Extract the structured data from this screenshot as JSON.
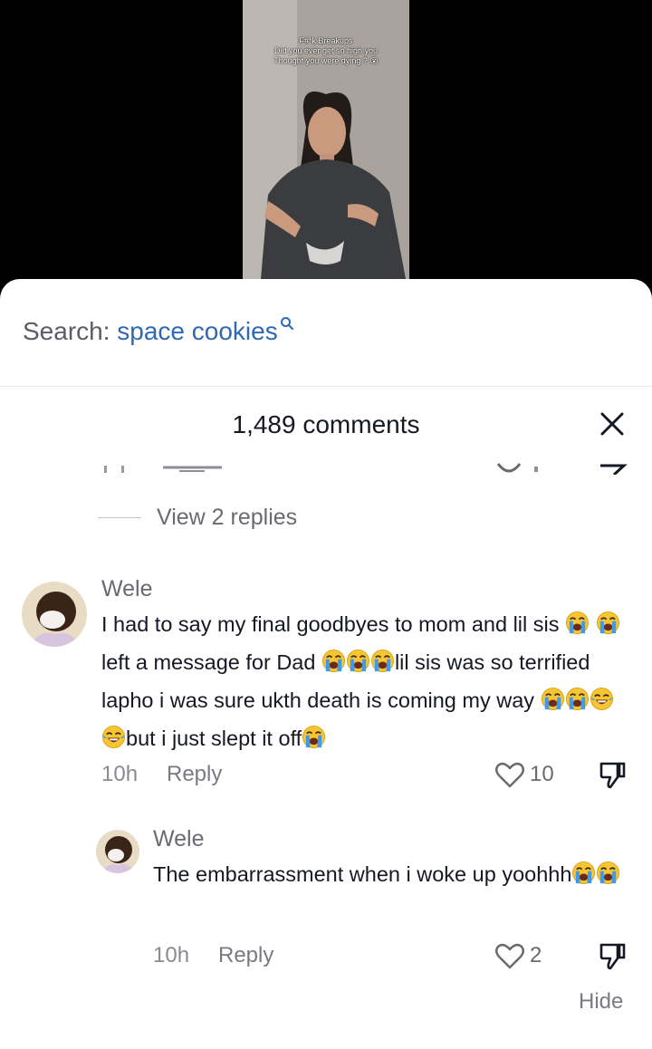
{
  "video": {
    "caption_lines": [
      "F#*k  Breakups",
      "Did you ever get so high you",
      "Thought you were dying ? 😵"
    ]
  },
  "search": {
    "prefix": "Search: ",
    "query": "space cookies"
  },
  "comments_header": {
    "title": "1,489 comments"
  },
  "prev_comment": {
    "view_replies": "View 2 replies"
  },
  "comments": [
    {
      "username": "Wele",
      "segments": [
        "I had to say my final goodbyes to mom and lil sis ",
        " left a message for Dad ",
        "lil sis was so terrified lapho i was sure ukth death is coming my way ",
        "but i just slept it off"
      ],
      "time": "10h",
      "reply_label": "Reply",
      "likes": "10"
    }
  ],
  "replies": [
    {
      "username": "Wele",
      "text": "The embarrassment when i woke up yoohhh",
      "time": "10h",
      "reply_label": "Reply",
      "likes": "2"
    }
  ],
  "hide_label": "Hide",
  "icons": {
    "crying": "loudly-crying-face-emoji",
    "laughing": "tears-of-joy-emoji",
    "heart": "heart-outline-icon",
    "dislike": "thumbs-down-outline-icon",
    "close": "close-icon",
    "search": "search-icon"
  },
  "colors": {
    "accent_blue": "#2f68b5",
    "text_primary": "#161823",
    "text_secondary": "#6a6a70",
    "emoji_face": "#f7c531",
    "emoji_tears": "#3f9be9"
  }
}
